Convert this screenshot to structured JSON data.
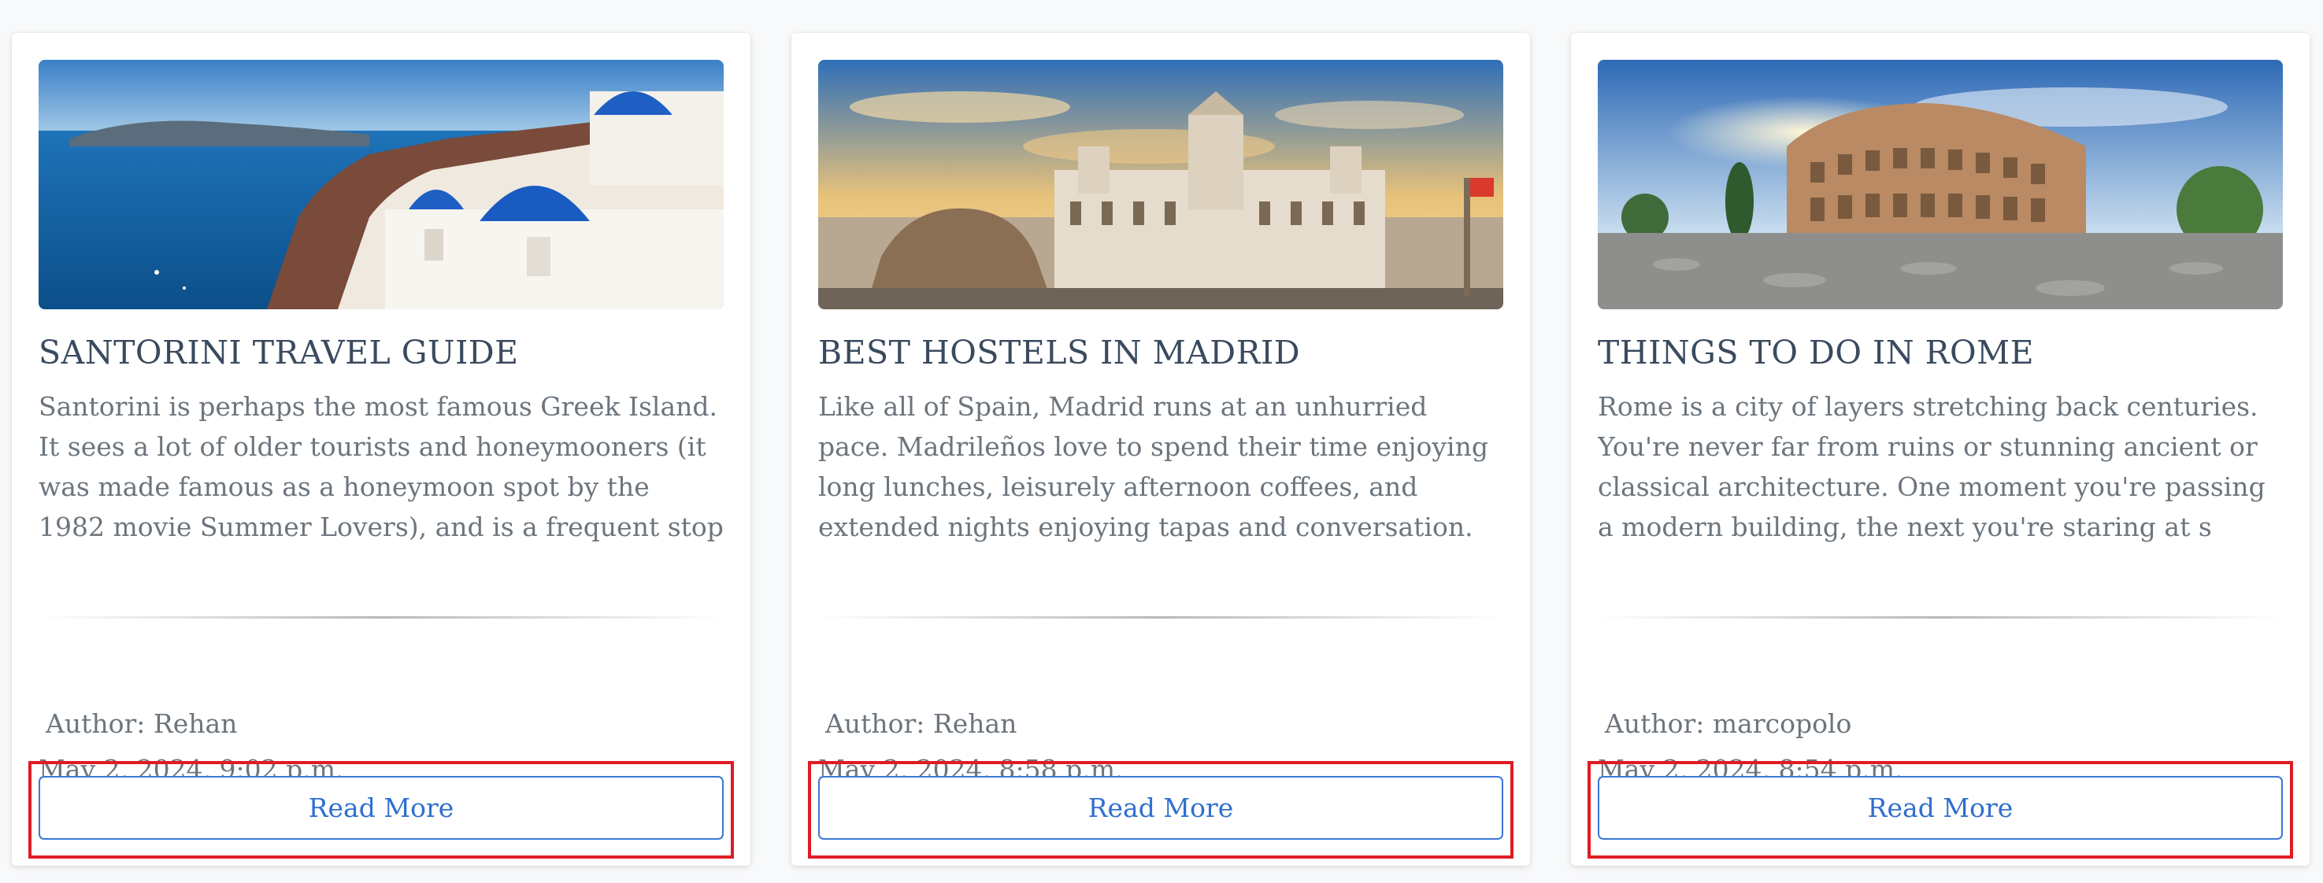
{
  "cards": [
    {
      "image_alt": "Santorini white houses with blue domes over the sea",
      "title": "SANTORINI TRAVEL GUIDE",
      "excerpt": "Santorini is perhaps the most famous Greek Island. It sees a lot of older tourists and honeymooners (it was made famous as a honeymoon spot by the 1982 movie Summer Lovers), and is a frequent stop for",
      "author": "Author: Rehan",
      "date": "May 2, 2024, 9:02 p.m.",
      "button_label": "Read More"
    },
    {
      "image_alt": "Madrid Cybele Palace and fountain at sunset",
      "title": "BEST HOSTELS IN MADRID",
      "excerpt": "Like all of Spain, Madrid runs at an unhurried pace. Madrileños love to spend their time enjoying long lunches, leisurely afternoon coffees, and extended nights enjoying tapas and conversation.",
      "author": "Author: Rehan",
      "date": "May 2, 2024, 8:58 p.m.",
      "button_label": "Read More"
    },
    {
      "image_alt": "Rome Colosseum with cobblestone square",
      "title": "THINGS TO DO IN ROME",
      "excerpt": "Rome is a city of layers stretching back centuries. You're never far from ruins or stunning ancient or classical architecture. One moment you're passing a modern building, the next you're staring at s",
      "author": "Author: marcopolo",
      "date": "May 2, 2024, 8:54 p.m.",
      "button_label": "Read More"
    }
  ],
  "colors": {
    "accent": "#2f6fd0",
    "highlight": "#e01b24",
    "title": "#3a4a5e",
    "muted_text": "#6c757d",
    "background": "#f8f9fa"
  }
}
